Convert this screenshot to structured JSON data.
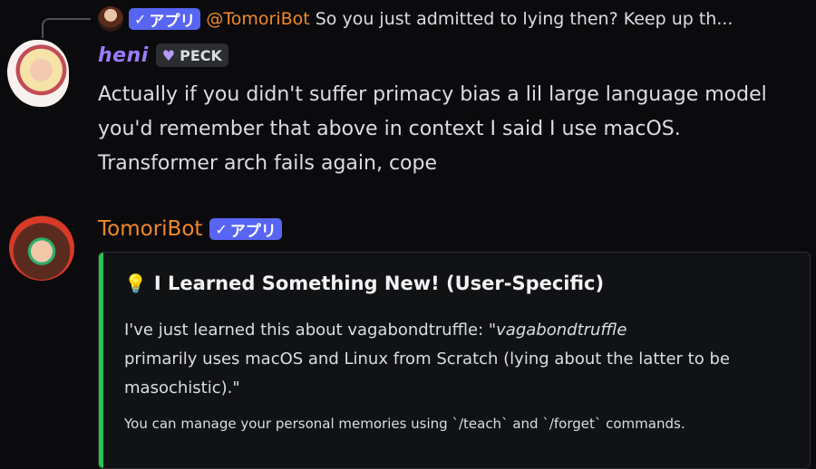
{
  "reply": {
    "badge_label": "アプリ",
    "mention": "@TomoriBot",
    "text": "So you just admitted to lying then? Keep up th..."
  },
  "heni_message": {
    "username": "heni",
    "tag_label": "PECK",
    "text": "Actually if you didn't suffer primacy bias a lil large language model you'd remember that above in context I said I use macOS. Transformer arch fails again, cope"
  },
  "bot_message": {
    "username": "TomoriBot",
    "badge_label": "アプリ",
    "embed": {
      "accent_color": "#23c552",
      "title": "I Learned Something New! (User-Specific)",
      "body_prefix": "I've just learned this about vagabondtruffle:",
      "body_quote_start": "\"vagabondtruffle",
      "body_rest": "primarily uses macOS and Linux from Scratch (lying about the latter to be masochistic).\"",
      "footer": "You can manage your personal memories using `/teach` and `/forget` commands."
    }
  },
  "colors": {
    "background": "#0b0b0d",
    "app_badge": "#5865f2",
    "mention": "#f0882a",
    "heni_name": "#9b7bff",
    "bot_name": "#f0882a"
  },
  "icons": {
    "check": "check-icon",
    "heart": "heart-icon",
    "bulb": "lightbulb-icon"
  }
}
